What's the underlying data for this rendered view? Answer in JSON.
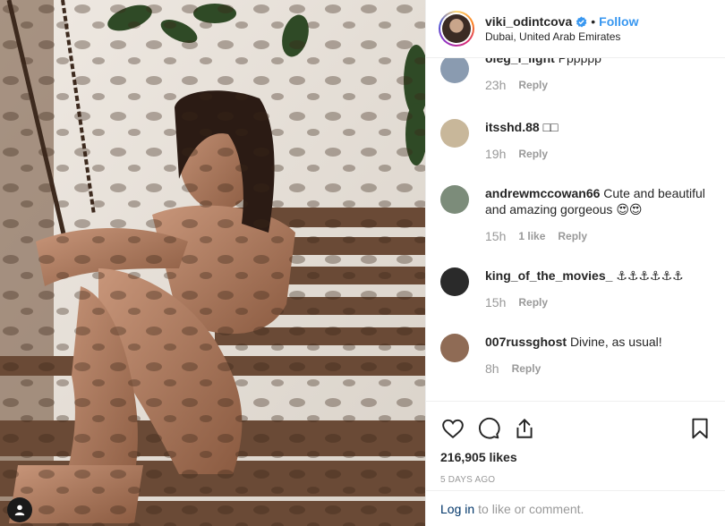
{
  "header": {
    "username": "viki_odintcova",
    "follow_label": "Follow",
    "separator": "•",
    "location": "Dubai, United Arab Emirates"
  },
  "comments": [
    {
      "user": "oleg_i_light",
      "text": "Pppppp",
      "time": "23h",
      "likes": "",
      "reply": "Reply",
      "avatar_color": "#8a9bb0"
    },
    {
      "user": "itsshd.88",
      "text": "□□",
      "time": "19h",
      "likes": "",
      "reply": "Reply",
      "avatar_color": "#c8b79a"
    },
    {
      "user": "andrewmccowan66",
      "text": "Cute and beautiful and amazing gorgeous 😍😍",
      "time": "15h",
      "likes": "1 like",
      "reply": "Reply",
      "avatar_color": "#7c8c7a"
    },
    {
      "user": "king_of_the_movies_",
      "text": "⚓⚓⚓⚓⚓⚓",
      "time": "15h",
      "likes": "",
      "reply": "Reply",
      "avatar_color": "#2a2a2a"
    },
    {
      "user": "007russghost",
      "text": "Divine, as usual!",
      "time": "8h",
      "likes": "",
      "reply": "Reply",
      "avatar_color": "#8f6b55"
    }
  ],
  "likes_count": "216,905 likes",
  "post_date": "5 DAYS AGO",
  "login_bar": {
    "login_label": "Log in",
    "rest": "to like or comment."
  },
  "colors": {
    "accent": "#3897f0",
    "verified": "#3897f0",
    "text": "#262626",
    "muted": "#999999"
  }
}
